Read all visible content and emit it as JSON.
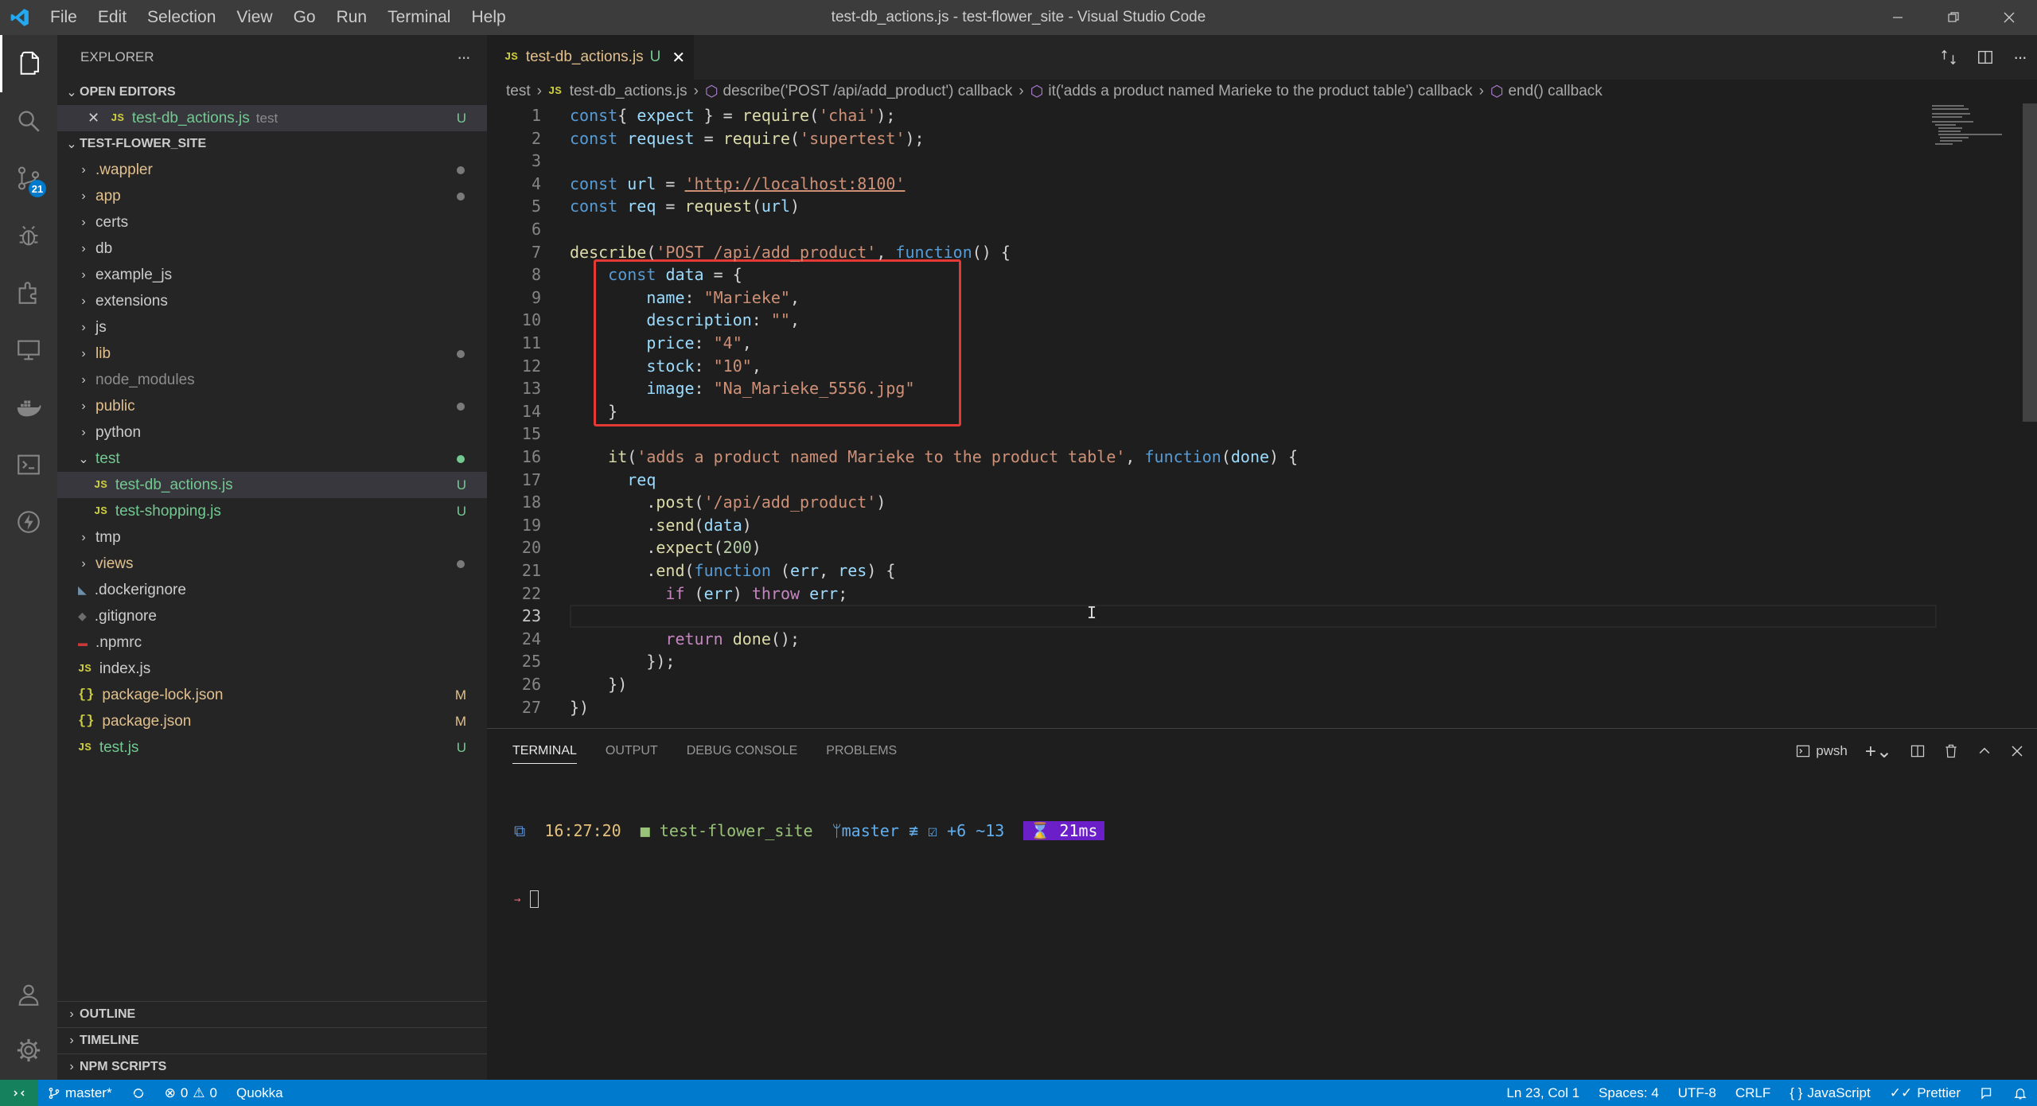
{
  "window": {
    "title": "test-db_actions.js - test-flower_site - Visual Studio Code",
    "menu": [
      "File",
      "Edit",
      "Selection",
      "View",
      "Go",
      "Run",
      "Terminal",
      "Help"
    ]
  },
  "activity_bar": {
    "scm_badge": "21"
  },
  "sidebar": {
    "header": "EXPLORER",
    "more": "···",
    "open_editors": {
      "title": "OPEN EDITORS",
      "items": [
        {
          "icon": "JS",
          "name": "test-db_actions.js",
          "folder": "test",
          "status": "U"
        }
      ]
    },
    "project": {
      "title": "TEST-FLOWER_SITE",
      "items": [
        {
          "name": ".wappler",
          "type": "folder",
          "status": "dot"
        },
        {
          "name": "app",
          "type": "folder",
          "status": "dot"
        },
        {
          "name": "certs",
          "type": "folder",
          "status": ""
        },
        {
          "name": "db",
          "type": "folder",
          "status": ""
        },
        {
          "name": "example_js",
          "type": "folder",
          "status": ""
        },
        {
          "name": "extensions",
          "type": "folder",
          "status": ""
        },
        {
          "name": "js",
          "type": "folder",
          "status": ""
        },
        {
          "name": "lib",
          "type": "folder",
          "status": "dot"
        },
        {
          "name": "node_modules",
          "type": "folder",
          "status": ""
        },
        {
          "name": "public",
          "type": "folder",
          "status": "dot"
        },
        {
          "name": "python",
          "type": "folder",
          "status": ""
        },
        {
          "name": "test",
          "type": "folder-open",
          "status": "green"
        },
        {
          "name": "test-db_actions.js",
          "type": "js-child",
          "status": "U"
        },
        {
          "name": "test-shopping.js",
          "type": "js-child",
          "status": "U"
        },
        {
          "name": "tmp",
          "type": "folder",
          "status": ""
        },
        {
          "name": "views",
          "type": "folder",
          "status": "dot"
        },
        {
          "name": ".dockerignore",
          "type": "file",
          "status": ""
        },
        {
          "name": ".gitignore",
          "type": "file",
          "status": ""
        },
        {
          "name": ".npmrc",
          "type": "file",
          "status": ""
        },
        {
          "name": "index.js",
          "type": "js",
          "status": ""
        },
        {
          "name": "package-lock.json",
          "type": "json",
          "status": "M"
        },
        {
          "name": "package.json",
          "type": "json",
          "status": "M"
        },
        {
          "name": "test.js",
          "type": "js",
          "status": "U"
        }
      ]
    },
    "bottom_sections": [
      "OUTLINE",
      "TIMELINE",
      "NPM SCRIPTS"
    ]
  },
  "tab": {
    "icon": "JS",
    "name": "test-db_actions.js",
    "status": "U"
  },
  "breadcrumb": [
    "test",
    "test-db_actions.js",
    "describe('POST /api/add_product') callback",
    "it('adds a product named Marieke to the product table') callback",
    "end() callback"
  ],
  "editor": {
    "current_line": 23,
    "lines": [
      [
        [
          "k",
          "const"
        ],
        [
          "",
          "{ "
        ],
        [
          "v",
          "expect"
        ],
        [
          "",
          " } = "
        ],
        [
          "f",
          "require"
        ],
        [
          "",
          "("
        ],
        [
          "s",
          "'chai'"
        ],
        [
          "",
          ");"
        ]
      ],
      [
        [
          "k",
          "const"
        ],
        [
          "",
          " "
        ],
        [
          "v",
          "request"
        ],
        [
          "",
          " = "
        ],
        [
          "f",
          "require"
        ],
        [
          "",
          "("
        ],
        [
          "s",
          "'supertest'"
        ],
        [
          "",
          ");"
        ]
      ],
      [],
      [
        [
          "k",
          "const"
        ],
        [
          "",
          " "
        ],
        [
          "v",
          "url"
        ],
        [
          "",
          " = "
        ],
        [
          "u",
          "'http://localhost:8100'"
        ]
      ],
      [
        [
          "k",
          "const"
        ],
        [
          "",
          " "
        ],
        [
          "v",
          "req"
        ],
        [
          "",
          " = "
        ],
        [
          "f",
          "request"
        ],
        [
          "",
          "("
        ],
        [
          "v",
          "url"
        ],
        [
          "",
          ")"
        ]
      ],
      [],
      [
        [
          "f",
          "describe"
        ],
        [
          "",
          "("
        ],
        [
          "s",
          "'POST /api/add_product'"
        ],
        [
          "",
          ", "
        ],
        [
          "k",
          "function"
        ],
        [
          "",
          "() {"
        ]
      ],
      [
        [
          "",
          "    "
        ],
        [
          "k",
          "const"
        ],
        [
          "",
          " "
        ],
        [
          "v",
          "data"
        ],
        [
          "",
          " = {"
        ]
      ],
      [
        [
          "",
          "        "
        ],
        [
          "v",
          "name"
        ],
        [
          "",
          ": "
        ],
        [
          "s",
          "\"Marieke\""
        ],
        [
          "",
          ","
        ]
      ],
      [
        [
          "",
          "        "
        ],
        [
          "v",
          "description"
        ],
        [
          "",
          ": "
        ],
        [
          "s",
          "\"\""
        ],
        [
          "",
          ","
        ]
      ],
      [
        [
          "",
          "        "
        ],
        [
          "v",
          "price"
        ],
        [
          "",
          ": "
        ],
        [
          "s",
          "\"4\""
        ],
        [
          "",
          ","
        ]
      ],
      [
        [
          "",
          "        "
        ],
        [
          "v",
          "stock"
        ],
        [
          "",
          ": "
        ],
        [
          "s",
          "\"10\""
        ],
        [
          "",
          ","
        ]
      ],
      [
        [
          "",
          "        "
        ],
        [
          "v",
          "image"
        ],
        [
          "",
          ": "
        ],
        [
          "s",
          "\"Na_Marieke_5556.jpg\""
        ]
      ],
      [
        [
          "",
          "    }"
        ]
      ],
      [],
      [
        [
          "",
          "    "
        ],
        [
          "f",
          "it"
        ],
        [
          "",
          "("
        ],
        [
          "s",
          "'adds a product named Marieke to the product table'"
        ],
        [
          "",
          ", "
        ],
        [
          "k",
          "function"
        ],
        [
          "",
          "("
        ],
        [
          "v",
          "done"
        ],
        [
          "",
          ") {"
        ]
      ],
      [
        [
          "",
          "      "
        ],
        [
          "v",
          "req"
        ]
      ],
      [
        [
          "",
          "        ."
        ],
        [
          "f",
          "post"
        ],
        [
          "",
          "("
        ],
        [
          "s",
          "'/api/add_product'"
        ],
        [
          "",
          ")"
        ]
      ],
      [
        [
          "",
          "        ."
        ],
        [
          "f",
          "send"
        ],
        [
          "",
          "("
        ],
        [
          "v",
          "data"
        ],
        [
          "",
          ")"
        ]
      ],
      [
        [
          "",
          "        ."
        ],
        [
          "f",
          "expect"
        ],
        [
          "",
          "("
        ],
        [
          "n",
          "200"
        ],
        [
          "",
          ")"
        ]
      ],
      [
        [
          "",
          "        ."
        ],
        [
          "f",
          "end"
        ],
        [
          "",
          "("
        ],
        [
          "k",
          "function"
        ],
        [
          "",
          " ("
        ],
        [
          "v",
          "err"
        ],
        [
          "",
          ", "
        ],
        [
          "v",
          "res"
        ],
        [
          "",
          ") {"
        ]
      ],
      [
        [
          "",
          "          "
        ],
        [
          "c",
          "if"
        ],
        [
          "",
          " ("
        ],
        [
          "v",
          "err"
        ],
        [
          "",
          ") "
        ],
        [
          "c",
          "throw"
        ],
        [
          "",
          " "
        ],
        [
          "v",
          "err"
        ],
        [
          "",
          ";"
        ]
      ],
      [],
      [
        [
          "",
          "          "
        ],
        [
          "c",
          "return"
        ],
        [
          "",
          " "
        ],
        [
          "f",
          "done"
        ],
        [
          "",
          "();"
        ]
      ],
      [
        [
          "",
          "        });"
        ]
      ],
      [
        [
          "",
          "    })"
        ]
      ],
      [
        [
          "",
          "})"
        ]
      ]
    ]
  },
  "panel": {
    "tabs": [
      "TERMINAL",
      "OUTPUT",
      "DEBUG CONSOLE",
      "PROBLEMS"
    ],
    "shell": "pwsh",
    "prompt": {
      "time": "16:27:20",
      "folder": "test-flower_site",
      "branch": "master",
      "git_status": "≢ ☑ +6 ~13",
      "duration": "21ms",
      "arrow": "→"
    }
  },
  "status_bar": {
    "branch": "master*",
    "errors": "0",
    "warnings": "0",
    "quokka": "Quokka",
    "position": "Ln 23, Col 1",
    "spaces": "Spaces: 4",
    "encoding": "UTF-8",
    "eol": "CRLF",
    "language": "JavaScript",
    "prettier": "Prettier"
  },
  "colors": {
    "accent": "#007acc",
    "highlight_box": "#e53935",
    "untracked": "#73c991",
    "modified": "#e2c08d"
  }
}
